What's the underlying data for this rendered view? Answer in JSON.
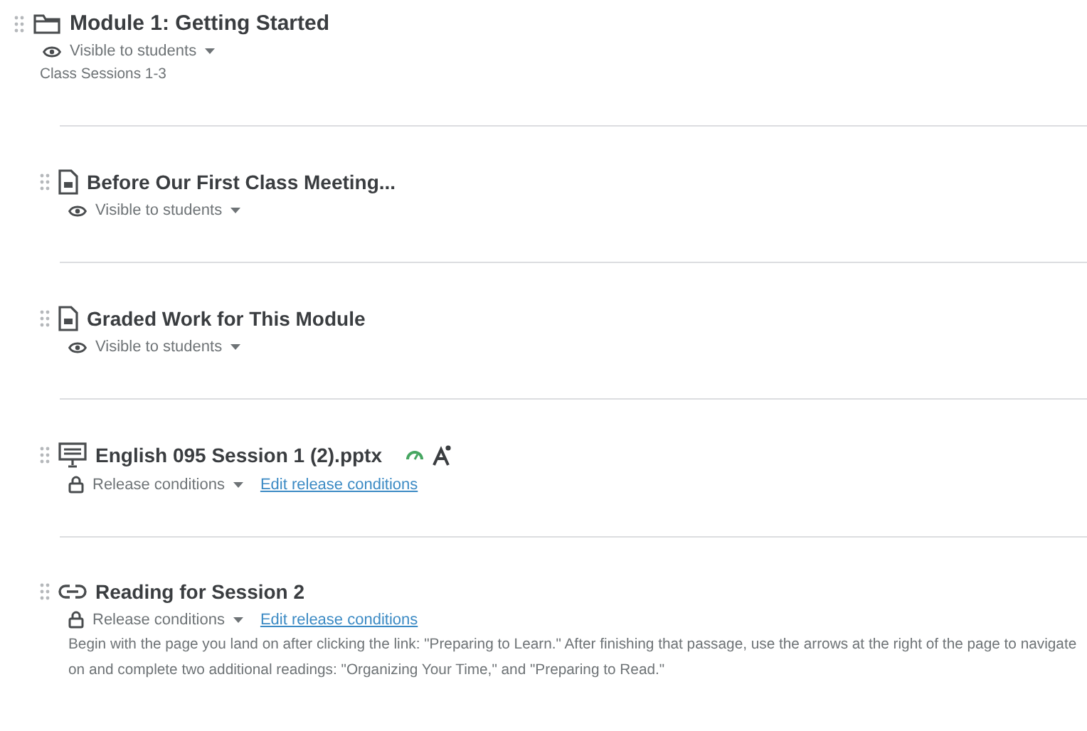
{
  "module": {
    "title": "Module 1: Getting Started",
    "visibility": "Visible to students",
    "description": "Class Sessions 1-3"
  },
  "items": [
    {
      "kind": "document",
      "title": "Before Our First Class Meeting...",
      "status": {
        "kind": "visibility",
        "label": "Visible to students"
      }
    },
    {
      "kind": "document",
      "title": "Graded Work for This Module",
      "status": {
        "kind": "visibility",
        "label": "Visible to students"
      }
    },
    {
      "kind": "presentation",
      "title": "English 095 Session 1 (2).pptx",
      "badges": true,
      "status": {
        "kind": "release",
        "label": "Release conditions",
        "link": "Edit release conditions"
      }
    },
    {
      "kind": "link",
      "title": "Reading for Session 2",
      "status": {
        "kind": "release",
        "label": "Release conditions",
        "link": "Edit release conditions"
      },
      "description": "Begin with the page you land on after clicking the link: \"Preparing to Learn.\" After finishing that passage, use the arrows at the right of the page to navigate on and complete two additional readings: \"Organizing Your Time,\" and \"Preparing to Read.\""
    }
  ]
}
